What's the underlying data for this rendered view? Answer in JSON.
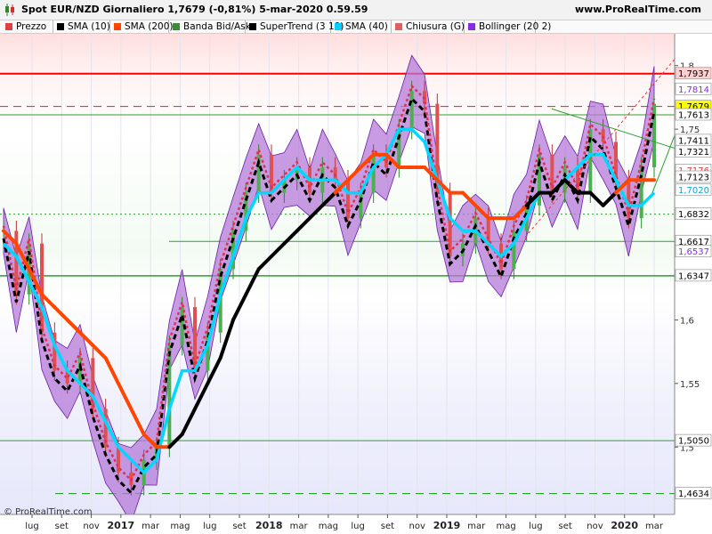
{
  "header": {
    "title": "Spot EUR/NZD Giornaliero 1,7679 (-0,81%) 5-mar-2020 0.59.59",
    "site": "www.ProRealTime.com"
  },
  "legend": [
    {
      "label": "Prezzo",
      "color": "#e04040"
    },
    {
      "label": "SMA (10)",
      "color": "#000000"
    },
    {
      "label": "SMA (200)",
      "color": "#ff4500"
    },
    {
      "label": "Banda Bid/Ask",
      "color": "#3c8c3c"
    },
    {
      "label": "SuperTrend (3 10)",
      "color": "#000000"
    },
    {
      "label": "SMA (40)",
      "color": "#00d0ff"
    },
    {
      "label": "Chiusura (G)",
      "color": "#e06060"
    },
    {
      "label": "Bollinger (20 2)",
      "color": "#8a2be2"
    }
  ],
  "copyright": "© ProRealTime.com",
  "chart_data": {
    "type": "line",
    "symbol": "EUR/NZD",
    "last_price": 1.7679,
    "ylim": [
      1.447,
      1.825
    ],
    "y_ticks": [
      {
        "value": 1.8,
        "label": "1,8"
      },
      {
        "value": 1.75,
        "label": "1,75"
      },
      {
        "value": 1.6,
        "label": "1,6"
      },
      {
        "value": 1.55,
        "label": "1,55"
      },
      {
        "value": 1.5,
        "label": "1,5"
      }
    ],
    "x_ticks": [
      "lug",
      "set",
      "nov",
      "2017",
      "mar",
      "mag",
      "lug",
      "set",
      "2018",
      "mar",
      "mag",
      "lug",
      "set",
      "nov",
      "2019",
      "mar",
      "mag",
      "lug",
      "set",
      "nov",
      "2020",
      "mar"
    ],
    "price_labels": [
      {
        "value": 1.7937,
        "label": "1,7937",
        "bg": "#ffd0d0",
        "color": "#000"
      },
      {
        "value": 1.7814,
        "label": "1,7814",
        "bg": "#ffffff",
        "color": "#8a2be2"
      },
      {
        "value": 1.7679,
        "label": "1,7679",
        "bg": "#ffff00",
        "color": "#000"
      },
      {
        "value": 1.7613,
        "label": "1,7613",
        "bg": "#ffffff",
        "color": "#000"
      },
      {
        "value": 1.7411,
        "label": "1,7411",
        "bg": "#ffffff",
        "color": "#000"
      },
      {
        "value": 1.7321,
        "label": "1,7321",
        "bg": "#ffffff",
        "color": "#000"
      },
      {
        "value": 1.7176,
        "label": "1,7176",
        "bg": "#ffffff",
        "color": "#e04040"
      },
      {
        "value": 1.7123,
        "label": "1,7123",
        "bg": "#ffffff",
        "color": "#000"
      },
      {
        "value": 1.702,
        "label": "1,7020",
        "bg": "#ffffff",
        "color": "#00a8e0"
      },
      {
        "value": 1.6832,
        "label": "1,6832",
        "bg": "#ffffff",
        "color": "#000"
      },
      {
        "value": 1.6617,
        "label": "1,6617",
        "bg": "#ffffff",
        "color": "#000"
      },
      {
        "value": 1.6537,
        "label": "1,6537",
        "bg": "#ffffff",
        "color": "#8a2be2"
      },
      {
        "value": 1.6347,
        "label": "1,6347",
        "bg": "#ffffff",
        "color": "#000"
      },
      {
        "value": 1.505,
        "label": "1,5050",
        "bg": "#ffffff",
        "color": "#000"
      },
      {
        "value": 1.4634,
        "label": "1,4634",
        "bg": "#ffffff",
        "color": "#000"
      }
    ],
    "h_lines": [
      {
        "value": 1.7937,
        "color": "#ff0000",
        "style": "solid",
        "width": 2
      },
      {
        "value": 1.7679,
        "color": "#ff3030",
        "style": "dashed",
        "width": 1.2
      },
      {
        "value": 1.7613,
        "color": "#2ca02c",
        "style": "solid",
        "width": 1
      },
      {
        "value": 1.6832,
        "color": "#2ca02c",
        "style": "dotted",
        "width": 1
      },
      {
        "value": 1.6617,
        "color": "#2ca02c",
        "style": "solid",
        "width": 1
      },
      {
        "value": 1.6347,
        "color": "#2ca02c",
        "style": "solid",
        "width": 1.5
      },
      {
        "value": 1.505,
        "color": "#2ca02c",
        "style": "solid",
        "width": 1
      },
      {
        "value": 1.4634,
        "color": "#2ca02c",
        "style": "dashed",
        "width": 1.2
      }
    ],
    "series": [
      {
        "name": "Prezzo",
        "values": [
          1.67,
          1.62,
          1.66,
          1.59,
          1.56,
          1.55,
          1.57,
          1.53,
          1.5,
          1.48,
          1.47,
          1.49,
          1.5,
          1.58,
          1.61,
          1.56,
          1.59,
          1.64,
          1.67,
          1.7,
          1.73,
          1.7,
          1.71,
          1.72,
          1.7,
          1.72,
          1.71,
          1.68,
          1.7,
          1.73,
          1.72,
          1.75,
          1.78,
          1.77,
          1.7,
          1.65,
          1.66,
          1.68,
          1.66,
          1.64,
          1.67,
          1.69,
          1.73,
          1.7,
          1.72,
          1.7,
          1.75,
          1.74,
          1.71,
          1.68,
          1.72,
          1.77
        ]
      },
      {
        "name": "SMA (40)",
        "values": [
          1.66,
          1.65,
          1.63,
          1.61,
          1.58,
          1.56,
          1.55,
          1.54,
          1.52,
          1.5,
          1.49,
          1.48,
          1.49,
          1.53,
          1.56,
          1.56,
          1.58,
          1.62,
          1.65,
          1.68,
          1.7,
          1.7,
          1.71,
          1.72,
          1.71,
          1.71,
          1.71,
          1.7,
          1.7,
          1.72,
          1.73,
          1.75,
          1.75,
          1.74,
          1.71,
          1.68,
          1.67,
          1.67,
          1.66,
          1.65,
          1.66,
          1.68,
          1.7,
          1.7,
          1.71,
          1.72,
          1.73,
          1.73,
          1.71,
          1.69,
          1.69,
          1.7
        ]
      },
      {
        "name": "SMA (200)",
        "values": [
          1.67,
          1.66,
          1.64,
          1.62,
          1.61,
          1.6,
          1.59,
          1.58,
          1.57,
          1.55,
          1.53,
          1.51,
          1.5,
          1.5,
          1.51,
          1.53,
          1.55,
          1.57,
          1.6,
          1.62,
          1.64,
          1.65,
          1.66,
          1.67,
          1.68,
          1.69,
          1.7,
          1.71,
          1.72,
          1.73,
          1.73,
          1.72,
          1.72,
          1.72,
          1.71,
          1.7,
          1.7,
          1.69,
          1.68,
          1.68,
          1.68,
          1.69,
          1.7,
          1.7,
          1.71,
          1.7,
          1.7,
          1.69,
          1.7,
          1.71,
          1.71,
          1.71
        ]
      }
    ]
  }
}
